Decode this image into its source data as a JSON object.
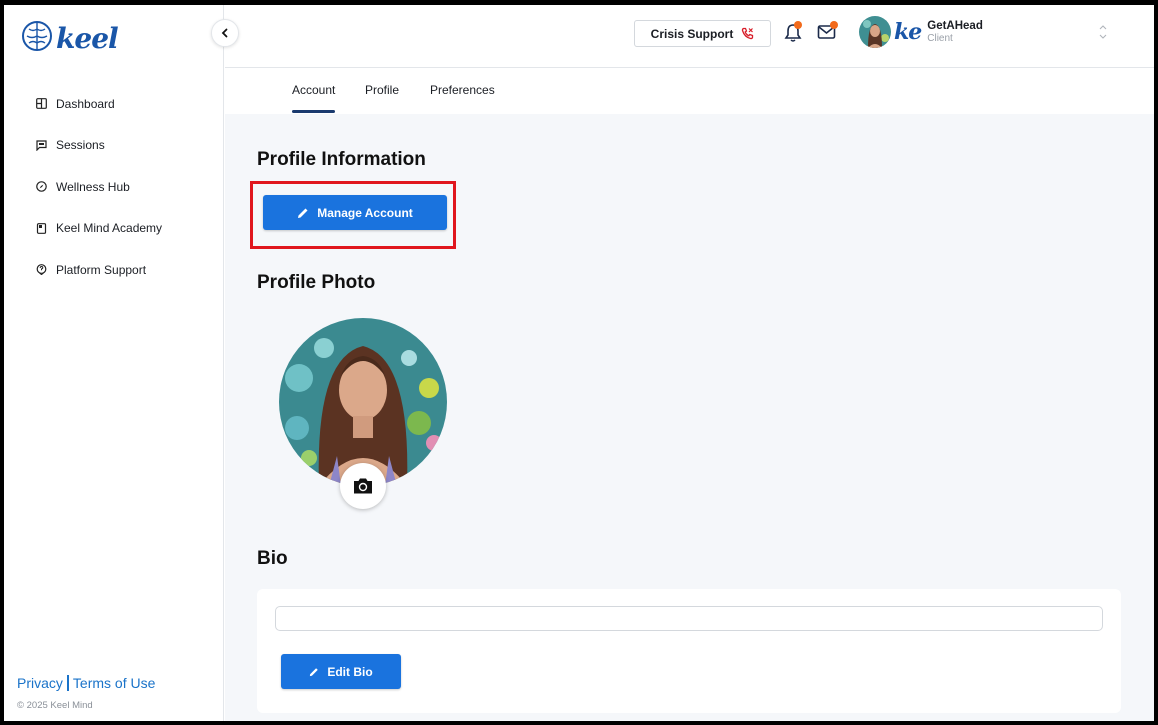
{
  "brand": {
    "logo_text": "keel",
    "accent": "#1a73de",
    "brand_blue": "#1a56a8",
    "notify_dot": "#f26a1b",
    "highlight": "#e0161e"
  },
  "sidebar": {
    "items": [
      {
        "label": "Dashboard",
        "icon": "grid-icon"
      },
      {
        "label": "Sessions",
        "icon": "chat-icon"
      },
      {
        "label": "Wellness Hub",
        "icon": "compass-icon"
      },
      {
        "label": "Keel Mind Academy",
        "icon": "book-icon"
      },
      {
        "label": "Platform Support",
        "icon": "help-icon"
      }
    ],
    "privacy": "Privacy",
    "terms": "Terms of Use",
    "copyright": "© 2025 Keel Mind"
  },
  "header": {
    "crisis_label": "Crisis Support",
    "org_logo": "ke",
    "user_name": "GetAHead",
    "user_role": "Client"
  },
  "tabs": [
    {
      "label": "Account",
      "active": true
    },
    {
      "label": "Profile",
      "active": false
    },
    {
      "label": "Preferences",
      "active": false
    }
  ],
  "main": {
    "profile_info_title": "Profile Information",
    "manage_account_label": "Manage Account",
    "profile_photo_title": "Profile Photo",
    "bio_title": "Bio",
    "bio_value": "",
    "edit_bio_label": "Edit Bio"
  }
}
